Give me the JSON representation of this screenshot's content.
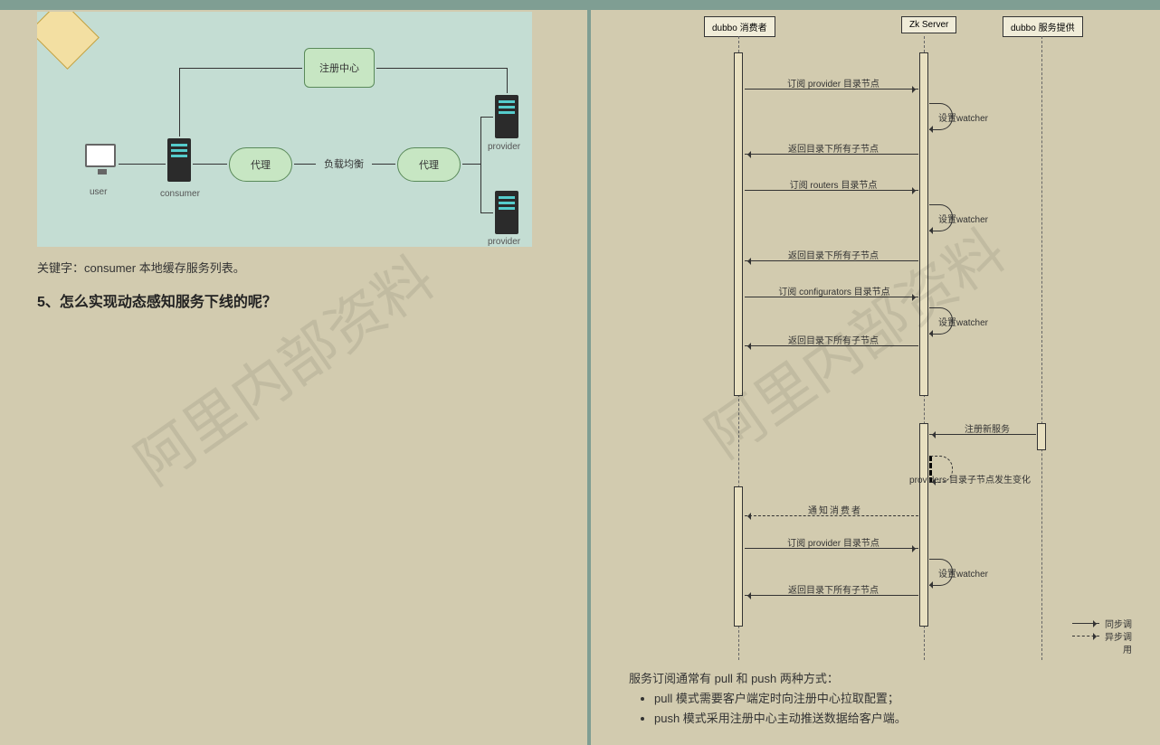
{
  "left": {
    "flow": {
      "registry": "注册中心",
      "proxy": "代理",
      "load_balance": "负载均衡",
      "user": "user",
      "consumer": "consumer",
      "provider": "provider"
    },
    "caption": "关键字：consumer 本地缓存服务列表。",
    "heading": "5、怎么实现动态感知服务下线的呢？",
    "watermark": "阿里内部资料"
  },
  "right": {
    "actors": {
      "consumer": "dubbo 消费者",
      "zk": "Zk Server",
      "provider": "dubbo 服务提供"
    },
    "messages": {
      "sub_provider": "订阅 provider 目录节点",
      "set_watcher": "设置watcher",
      "return_children": "返回目录下所有子节点",
      "sub_routers": "订阅 routers 目录节点",
      "sub_configurators": "订阅 configurators 目录节点",
      "register_new": "注册新服务",
      "providers_changed": "providers 目录子节点发生变化",
      "notify_consumer": "通知消费者",
      "sub_provider2": "订阅 provider 目录节点"
    },
    "legend": {
      "sync": "同步调",
      "async": "异步调",
      "yong": "用"
    },
    "body": {
      "intro": "服务订阅通常有 pull 和 push 两种方式：",
      "li1": "pull 模式需要客户端定时向注册中心拉取配置；",
      "li2": "push 模式采用注册中心主动推送数据给客户端。"
    },
    "watermark": "阿里内部资料"
  }
}
